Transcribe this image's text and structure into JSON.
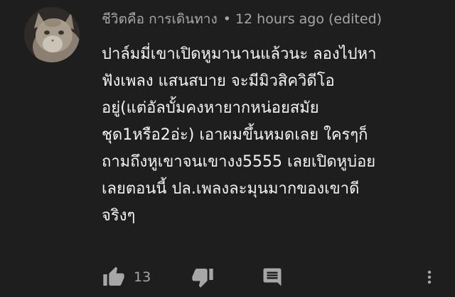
{
  "comment": {
    "author": "ชีวิตคือ การเดินทาง",
    "separator": "•",
    "timestamp": "12 hours ago (edited)",
    "lines": [
      "ปาล์มมี่เขาเปิดหูมานานแล้วนะ ลองไปหา",
      "ฟังเพลง แสนสบาย จะมีมิวสิควิดีโอ",
      "อยู่(แต่อัลบั้มคงหายากหน่อยสมัย",
      "ชุด1หรือ2อ่ะ) เอาผมขึ้นหมดเลย ใครๆก็",
      "ถามถึงหูเขาจนเขางง5555 เลยเปิดหูบ่อย",
      "เลยตอนนี้ ปล.เพลงละมุนมากของเขาดี",
      "จริงๆ"
    ]
  },
  "actions": {
    "like_icon": "thumbs-up-icon",
    "like_count": "13",
    "dislike_icon": "thumbs-down-icon",
    "reply_icon": "comment-icon",
    "more_icon": "more-vertical-icon"
  },
  "colors": {
    "background": "#1e1e1e",
    "text_primary": "#f2f2f2",
    "text_secondary": "#a7a7a7"
  }
}
